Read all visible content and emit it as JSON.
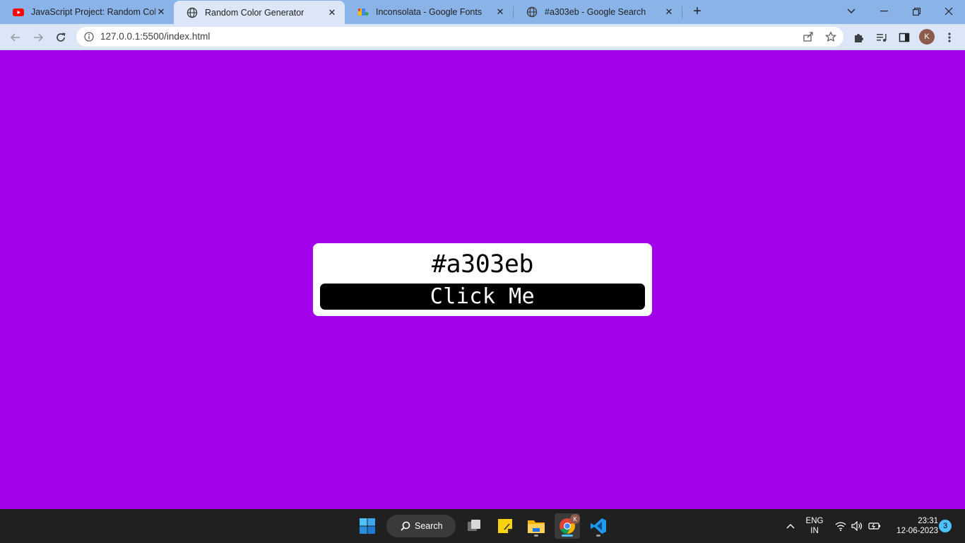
{
  "browser": {
    "tabs": [
      {
        "title": "JavaScript Project: Random Colo",
        "favicon": "youtube-icon",
        "active": false
      },
      {
        "title": "Random Color Generator",
        "favicon": "globe-icon",
        "active": true
      },
      {
        "title": "Inconsolata - Google Fonts",
        "favicon": "google-fonts-icon",
        "active": false
      },
      {
        "title": "#a303eb - Google Search",
        "favicon": "globe-icon",
        "active": false
      }
    ],
    "url": "127.0.0.1:5500/index.html",
    "profile_initial": "K"
  },
  "page": {
    "background_color": "#a303eb",
    "color_code": "#a303eb",
    "button_label": "Click Me"
  },
  "taskbar": {
    "search_label": "Search",
    "language_line1": "ENG",
    "language_line2": "IN",
    "time": "23:31",
    "date": "12-06-2023",
    "notification_count": "3",
    "chrome_badge": "K"
  },
  "colors": {
    "accent": "#4cc2ff",
    "tabstrip": "#8ab4e8",
    "toolbar": "#dbe7f7",
    "taskbar": "#202020"
  }
}
